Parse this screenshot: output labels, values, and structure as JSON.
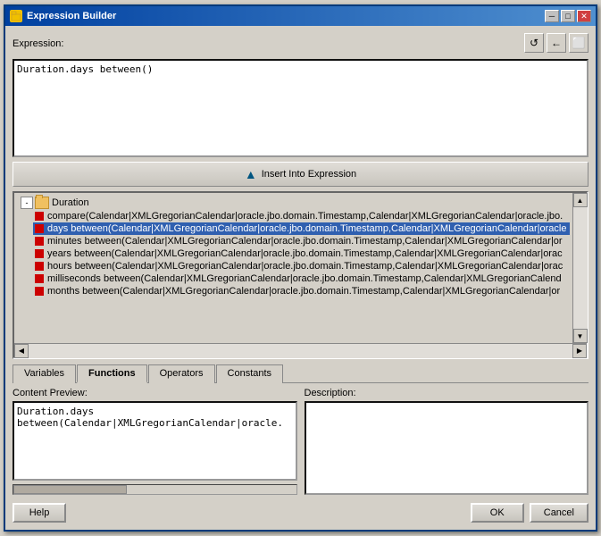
{
  "window": {
    "title": "Expression Builder",
    "icon": "★"
  },
  "titleButtons": {
    "minimize": "─",
    "maximize": "□",
    "close": "✕"
  },
  "toolbar": {
    "refresh": "↺",
    "back": "←",
    "copy": "⬜"
  },
  "expressionLabel": "Expression:",
  "expressionValue": "Duration.days between()",
  "insertButton": "Insert Into Expression",
  "tree": {
    "folder": {
      "name": "Duration",
      "expanded": true,
      "items": [
        "compare(Calendar|XMLGregorianCalendar|oracle.jbo.domain.Timestamp,Calendar|XMLGregorianCalendar|oracle.jbo.",
        "days between(Calendar|XMLGregorianCalendar|oracle.jbo.domain.Timestamp,Calendar|XMLGregorianCalendar|oracle",
        "minutes between(Calendar|XMLGregorianCalendar|oracle.jbo.domain.Timestamp,Calendar|XMLGregorianCalendar|or",
        "years between(Calendar|XMLGregorianCalendar|oracle.jbo.domain.Timestamp,Calendar|XMLGregorianCalendar|orac",
        "hours between(Calendar|XMLGregorianCalendar|oracle.jbo.domain.Timestamp,Calendar|XMLGregorianCalendar|orac",
        "milliseconds between(Calendar|XMLGregorianCalendar|oracle.jbo.domain.Timestamp,Calendar|XMLGregorianCalend",
        "months between(Calendar|XMLGregorianCalendar|oracle.jbo.domain.Timestamp,Calendar|XMLGregorianCalendar|or"
      ]
    }
  },
  "tabs": [
    {
      "label": "Variables",
      "active": false
    },
    {
      "label": "Functions",
      "active": true
    },
    {
      "label": "Operators",
      "active": false
    },
    {
      "label": "Constants",
      "active": false
    }
  ],
  "contentPreviewLabel": "Content Preview:",
  "contentPreviewValue": "Duration.days between(Calendar|XMLGregorianCalendar|oracle.",
  "descriptionLabel": "Description:",
  "buttons": {
    "help": "Help",
    "ok": "OK",
    "cancel": "Cancel"
  },
  "colors": {
    "selectedRow": "#3060b0",
    "accent": "#0040a0"
  }
}
